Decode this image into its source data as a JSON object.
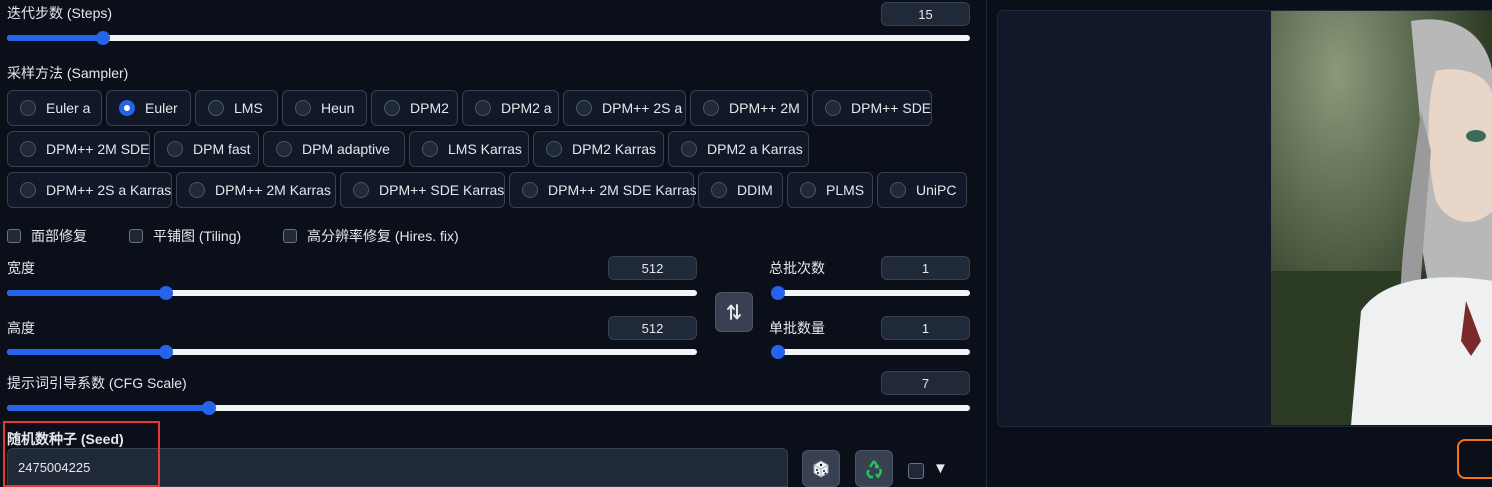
{
  "steps": {
    "label": "迭代步数 (Steps)",
    "value": "15",
    "fraction": 0.1
  },
  "sampler": {
    "label": "采样方法 (Sampler)",
    "selected": "Euler",
    "rows": [
      [
        "Euler a",
        "Euler",
        "LMS",
        "Heun",
        "DPM2",
        "DPM2 a",
        "DPM++ 2S a",
        "DPM++ 2M",
        "DPM++ SDE"
      ],
      [
        "DPM++ 2M SDE",
        "DPM fast",
        "DPM adaptive",
        "LMS Karras",
        "DPM2 Karras",
        "DPM2 a Karras"
      ],
      [
        "DPM++ 2S a Karras",
        "DPM++ 2M Karras",
        "DPM++ SDE Karras",
        "DPM++ 2M SDE Karras",
        "DDIM",
        "PLMS",
        "UniPC"
      ]
    ]
  },
  "options": {
    "face_restore": "面部修复",
    "tiling": "平铺图 (Tiling)",
    "hires_fix": "高分辨率修复 (Hires. fix)"
  },
  "width": {
    "label": "宽度",
    "value": "512",
    "fraction": 0.23
  },
  "height": {
    "label": "高度",
    "value": "512",
    "fraction": 0.23
  },
  "swap_icon": "swap-vertical-arrows",
  "batch_count": {
    "label": "总批次数",
    "value": "1",
    "fraction": 0.0
  },
  "batch_size": {
    "label": "单批数量",
    "value": "1",
    "fraction": 0.0
  },
  "cfg": {
    "label": "提示词引导系数 (CFG Scale)",
    "value": "7",
    "fraction": 0.21
  },
  "seed": {
    "label": "随机数种子 (Seed)",
    "value": "2475004225",
    "random_icon": "dice-icon",
    "reuse_icon": "recycle-icon",
    "extra_toggle": "▼"
  },
  "colors": {
    "accent": "#2563eb",
    "highlight": "#e53935",
    "orange": "#f97316",
    "bg": "#0b0f19"
  }
}
